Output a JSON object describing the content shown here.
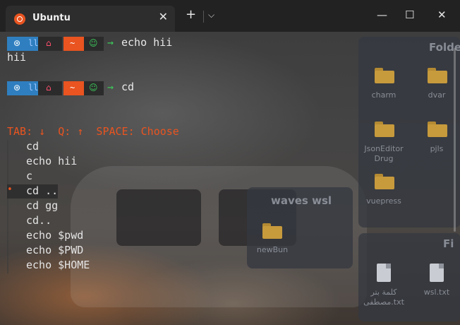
{
  "window": {
    "tab_title": "Ubuntu",
    "tab_close": "✕",
    "new_tab": "+",
    "dropdown": "⌵",
    "minimize": "—",
    "maximize": "☐",
    "close": "✕"
  },
  "colors": {
    "prompt_blue": "#2f7fc0",
    "prompt_dark": "#2b2b2b",
    "prompt_orange": "#e95420",
    "prompt_green_icon": "#3cc95a",
    "arrow_green": "#3cc95a",
    "hint_orange": "#e95420"
  },
  "terminal": {
    "prompts": [
      {
        "git": "ll",
        "dir": "~",
        "arrow": "→",
        "command": "echo hii"
      },
      {
        "git": "ll",
        "dir": "~",
        "arrow": "→",
        "command": "cd"
      }
    ],
    "output": "hii",
    "hint": "TAB: ↓  Q: ↑  SPACE: Choose",
    "menu_marker": "•",
    "menu_items": [
      "cd",
      "echo hii",
      "c",
      "cd ..",
      "cd gg",
      "cd..",
      "echo $pwd",
      "echo $PWD",
      "echo $HOME"
    ],
    "selected_index": 3
  },
  "desktop": {
    "folders_title": "Folde",
    "folders": [
      "charm",
      "dvar",
      "JsonEditor\nDrug",
      "pjls",
      "vuepress"
    ],
    "waves_title": "waves wsl",
    "waves_item": "newBun",
    "files_title": "Fi",
    "files": [
      "كلمة بتر\nمصطفى.txt",
      "wsl.txt"
    ]
  }
}
